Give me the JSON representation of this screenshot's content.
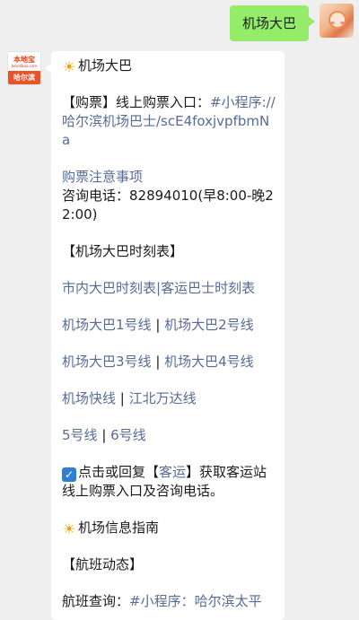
{
  "outgoing": {
    "text": "机场大巴"
  },
  "incoming": {
    "avatar": {
      "logo_main": "本地宝",
      "logo_sub": "bendibao.com",
      "city": "哈尔滨"
    },
    "title": {
      "icon": "sun-icon",
      "text": "机场大巴"
    },
    "ticket": {
      "prefix": "【购票】线上购票入口：",
      "link": "#小程序://哈尔滨机场巴士/scE4foxjvpfbmNa"
    },
    "notes_link": "购票注意事项",
    "phone": "咨询电话：82894010(早8:00-晚22:00)",
    "schedule_heading": "【机场大巴时刻表】",
    "schedule_links": {
      "a": "市内大巴时刻表",
      "sep": "|",
      "b": "客运巴士时刻表"
    },
    "lines_row1": {
      "a": "机场大巴1号线",
      "sep": " | ",
      "b": "机场大巴2号线"
    },
    "lines_row2": {
      "a": "机场大巴3号线",
      "sep": " | ",
      "b": "机场大巴4号线"
    },
    "lines_row3": {
      "a": "机场快线",
      "sep": " | ",
      "b": "江北万达线"
    },
    "lines_row4": {
      "a": "5号线",
      "sep": " | ",
      "b": "6号线"
    },
    "reply_hint": {
      "icon": "checkbox-icon",
      "before": "点击或回复【",
      "keyword": "客运",
      "after": "】获取客运站线上购票入口及咨询电话。"
    },
    "info_title": {
      "icon": "sun-icon",
      "text": "机场信息指南"
    },
    "flight_heading": "【航班动态】",
    "flight_query": {
      "prefix": "航班查询：",
      "link": "#小程序：哈尔滨太平"
    }
  },
  "colors": {
    "outgoing_bubble": "#95ec69",
    "link": "#576b95",
    "background": "#efefef",
    "brand": "#e8542a"
  }
}
